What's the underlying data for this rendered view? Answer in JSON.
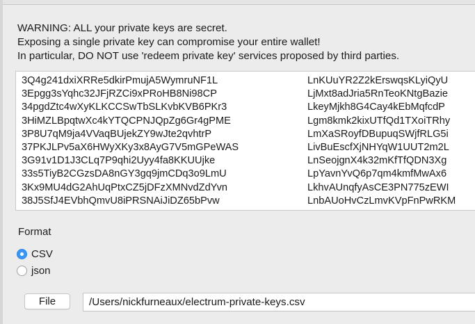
{
  "warning": {
    "line1": "WARNING: ALL your private keys are secret.",
    "line2": "Exposing a single private key can compromise your entire wallet!",
    "line3": "In particular, DO NOT use 'redeem private key' services proposed by third parties."
  },
  "keys": {
    "rows": [
      {
        "address": "3Q4g241dxiXRRe5dkirPmujA5WymruNF1L",
        "key": "LnKUuYR2Z2kErswqsKLyiQyU"
      },
      {
        "address": "3Epgg3sYqhc32JFjRZCi9xPRoHB8Ni98CP",
        "key": "LjMxt8adJria5RnTeoKNtgBazie"
      },
      {
        "address": "34pgdZtc4wXyKLKCCSwTbSLKvbKVB6PKr3",
        "key": "LkeyMjkh8G4Cay4kEbMqfcdP"
      },
      {
        "address": "3HiMZLBpqtwXc4kYTQCPNJQpZg6Gr4gPME",
        "key": "Lgm8kmk2kixUTfQd1TXoiTRhy"
      },
      {
        "address": "3P8U7qM9ja4VVaqBUjekZY9wJte2qvhtrP",
        "key": "LmXaSRoyfDBupuqSWjfRLG5i"
      },
      {
        "address": "37PKJLPv5aX6HWyXKy3x8AyG7V5mGPeWAS",
        "key": "LivBuEscfXjNHYqW1UUT2m2L"
      },
      {
        "address": "3G91v1D1J3CLq7P9qhi2Uyy4fa8KKUUjke",
        "key": "LnSeojgnX4k32mKfTfQDN3Xg"
      },
      {
        "address": "33s5TiyB2CGzsDA8nGY3gq9jmCDq3o9LmU",
        "key": "LpYavnYvQ6p7qm4kmfMwAx6"
      },
      {
        "address": "3Kx9MU4dG2AhUqPtxCZ5jDFzXMNvdZdYvn",
        "key": "LkhvAUnqfyAsCE3PN775zEWI"
      },
      {
        "address": "38J5SfJ4EVbhQmvU8iPRSNAiJiDZ65bPvw",
        "key": "LnbAUoHvCzLmvKVpFnPwRKM"
      }
    ]
  },
  "format": {
    "label": "Format",
    "options": [
      {
        "label": "CSV",
        "selected": true
      },
      {
        "label": "json",
        "selected": false
      }
    ]
  },
  "file": {
    "button_label": "File",
    "path": "/Users/nickfurneaux/electrum-private-keys.csv"
  }
}
